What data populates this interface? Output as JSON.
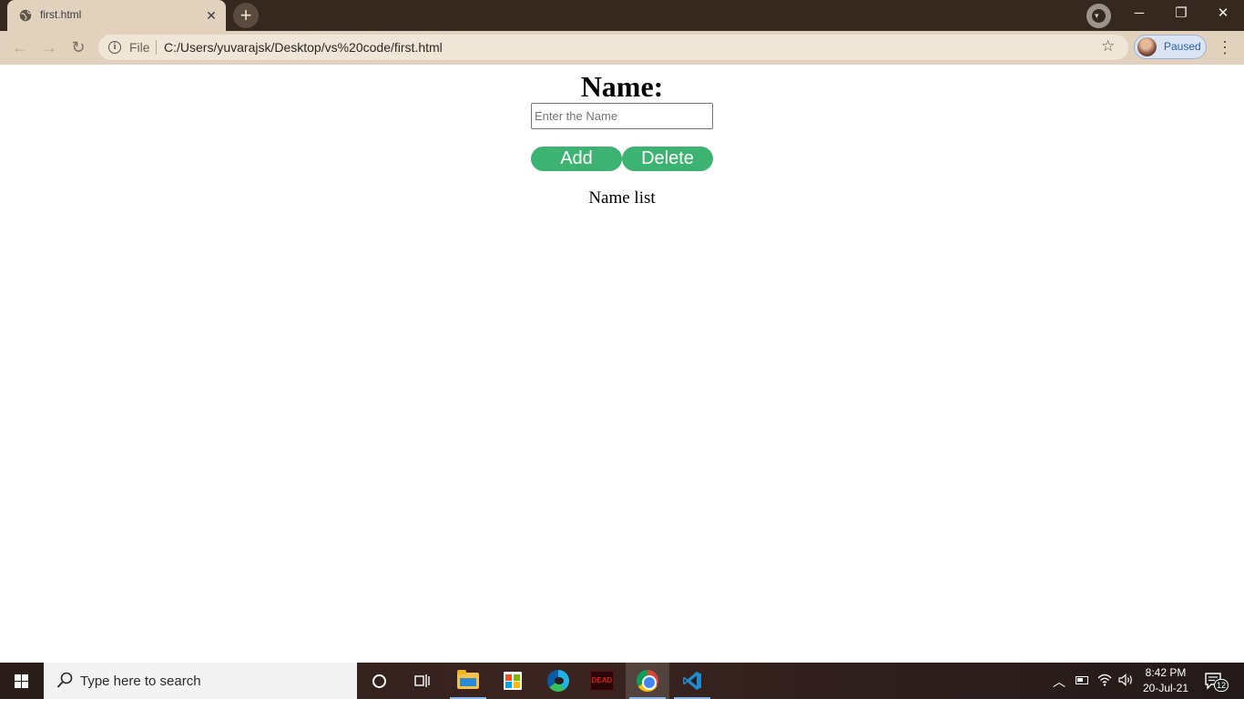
{
  "browser": {
    "tab": {
      "title": "first.html",
      "close_glyph": "✕"
    },
    "new_tab_glyph": "+",
    "window_controls": {
      "minimize": "─",
      "restore": "❐",
      "close": "✕"
    },
    "omnibox": {
      "scheme_label": "File",
      "url": "C:/Users/yuvarajsk/Desktop/vs%20code/first.html"
    },
    "profile": {
      "label": "Paused"
    },
    "theme_colors": {
      "frame": "#35291f",
      "toolbar": "#e2d2bd"
    }
  },
  "page": {
    "heading": "Name:",
    "name_input": {
      "placeholder": "Enter the Name",
      "value": ""
    },
    "add_button": "Add",
    "delete_button": "Delete",
    "list_title": "Name list",
    "accent_color": "#3cb371"
  },
  "taskbar": {
    "search_placeholder": "Type here to search",
    "pinned_apps": [
      "cortana",
      "task-view",
      "file-explorer",
      "microsoft-store",
      "edge",
      "game",
      "chrome",
      "vscode"
    ],
    "active_app": "chrome",
    "clock": {
      "time": "8:42 PM",
      "date": "20-Jul-21"
    },
    "notification_count": "12"
  }
}
